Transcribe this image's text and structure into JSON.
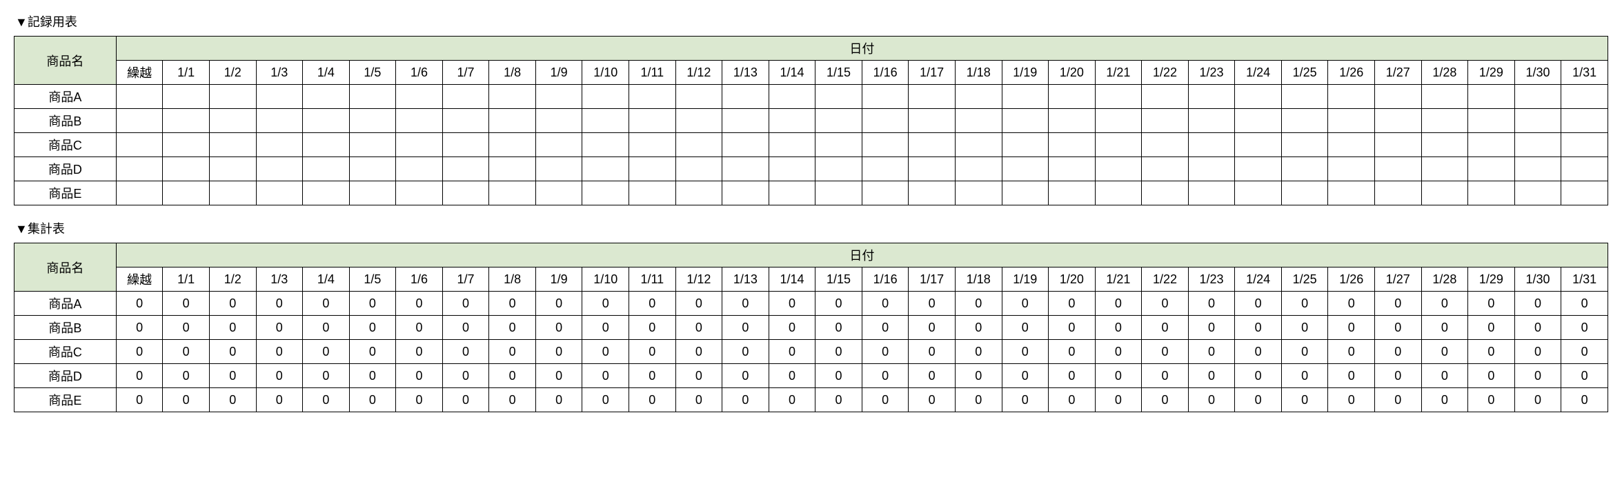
{
  "record_table": {
    "title": "▼記録用表",
    "headers": {
      "product": "商品名",
      "date_super": "日付",
      "columns": [
        "繰越",
        "1/1",
        "1/2",
        "1/3",
        "1/4",
        "1/5",
        "1/6",
        "1/7",
        "1/8",
        "1/9",
        "1/10",
        "1/11",
        "1/12",
        "1/13",
        "1/14",
        "1/15",
        "1/16",
        "1/17",
        "1/18",
        "1/19",
        "1/20",
        "1/21",
        "1/22",
        "1/23",
        "1/24",
        "1/25",
        "1/26",
        "1/27",
        "1/28",
        "1/29",
        "1/30",
        "1/31"
      ]
    },
    "rows": [
      {
        "name": "商品A",
        "cells": [
          "",
          "",
          "",
          "",
          "",
          "",
          "",
          "",
          "",
          "",
          "",
          "",
          "",
          "",
          "",
          "",
          "",
          "",
          "",
          "",
          "",
          "",
          "",
          "",
          "",
          "",
          "",
          "",
          "",
          "",
          "",
          ""
        ]
      },
      {
        "name": "商品B",
        "cells": [
          "",
          "",
          "",
          "",
          "",
          "",
          "",
          "",
          "",
          "",
          "",
          "",
          "",
          "",
          "",
          "",
          "",
          "",
          "",
          "",
          "",
          "",
          "",
          "",
          "",
          "",
          "",
          "",
          "",
          "",
          "",
          ""
        ]
      },
      {
        "name": "商品C",
        "cells": [
          "",
          "",
          "",
          "",
          "",
          "",
          "",
          "",
          "",
          "",
          "",
          "",
          "",
          "",
          "",
          "",
          "",
          "",
          "",
          "",
          "",
          "",
          "",
          "",
          "",
          "",
          "",
          "",
          "",
          "",
          "",
          ""
        ]
      },
      {
        "name": "商品D",
        "cells": [
          "",
          "",
          "",
          "",
          "",
          "",
          "",
          "",
          "",
          "",
          "",
          "",
          "",
          "",
          "",
          "",
          "",
          "",
          "",
          "",
          "",
          "",
          "",
          "",
          "",
          "",
          "",
          "",
          "",
          "",
          "",
          ""
        ]
      },
      {
        "name": "商品E",
        "cells": [
          "",
          "",
          "",
          "",
          "",
          "",
          "",
          "",
          "",
          "",
          "",
          "",
          "",
          "",
          "",
          "",
          "",
          "",
          "",
          "",
          "",
          "",
          "",
          "",
          "",
          "",
          "",
          "",
          "",
          "",
          "",
          ""
        ]
      }
    ]
  },
  "summary_table": {
    "title": "▼集計表",
    "headers": {
      "product": "商品名",
      "date_super": "日付",
      "columns": [
        "繰越",
        "1/1",
        "1/2",
        "1/3",
        "1/4",
        "1/5",
        "1/6",
        "1/7",
        "1/8",
        "1/9",
        "1/10",
        "1/11",
        "1/12",
        "1/13",
        "1/14",
        "1/15",
        "1/16",
        "1/17",
        "1/18",
        "1/19",
        "1/20",
        "1/21",
        "1/22",
        "1/23",
        "1/24",
        "1/25",
        "1/26",
        "1/27",
        "1/28",
        "1/29",
        "1/30",
        "1/31"
      ]
    },
    "rows": [
      {
        "name": "商品A",
        "cells": [
          "0",
          "0",
          "0",
          "0",
          "0",
          "0",
          "0",
          "0",
          "0",
          "0",
          "0",
          "0",
          "0",
          "0",
          "0",
          "0",
          "0",
          "0",
          "0",
          "0",
          "0",
          "0",
          "0",
          "0",
          "0",
          "0",
          "0",
          "0",
          "0",
          "0",
          "0",
          "0"
        ]
      },
      {
        "name": "商品B",
        "cells": [
          "0",
          "0",
          "0",
          "0",
          "0",
          "0",
          "0",
          "0",
          "0",
          "0",
          "0",
          "0",
          "0",
          "0",
          "0",
          "0",
          "0",
          "0",
          "0",
          "0",
          "0",
          "0",
          "0",
          "0",
          "0",
          "0",
          "0",
          "0",
          "0",
          "0",
          "0",
          "0"
        ]
      },
      {
        "name": "商品C",
        "cells": [
          "0",
          "0",
          "0",
          "0",
          "0",
          "0",
          "0",
          "0",
          "0",
          "0",
          "0",
          "0",
          "0",
          "0",
          "0",
          "0",
          "0",
          "0",
          "0",
          "0",
          "0",
          "0",
          "0",
          "0",
          "0",
          "0",
          "0",
          "0",
          "0",
          "0",
          "0",
          "0"
        ]
      },
      {
        "name": "商品D",
        "cells": [
          "0",
          "0",
          "0",
          "0",
          "0",
          "0",
          "0",
          "0",
          "0",
          "0",
          "0",
          "0",
          "0",
          "0",
          "0",
          "0",
          "0",
          "0",
          "0",
          "0",
          "0",
          "0",
          "0",
          "0",
          "0",
          "0",
          "0",
          "0",
          "0",
          "0",
          "0",
          "0"
        ]
      },
      {
        "name": "商品E",
        "cells": [
          "0",
          "0",
          "0",
          "0",
          "0",
          "0",
          "0",
          "0",
          "0",
          "0",
          "0",
          "0",
          "0",
          "0",
          "0",
          "0",
          "0",
          "0",
          "0",
          "0",
          "0",
          "0",
          "0",
          "0",
          "0",
          "0",
          "0",
          "0",
          "0",
          "0",
          "0",
          "0"
        ]
      }
    ]
  }
}
